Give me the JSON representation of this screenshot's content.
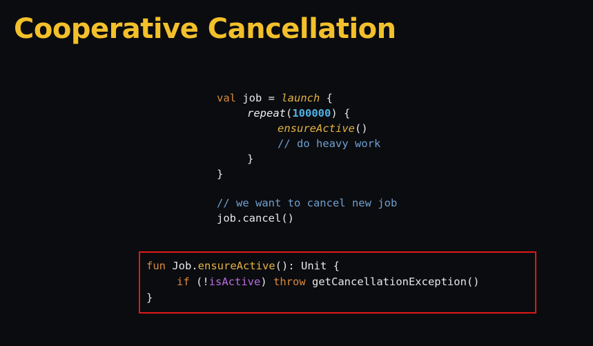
{
  "slide": {
    "title": "Cooperative Cancellation"
  },
  "code_top": {
    "l1_kw": "val",
    "l1_var": " job = ",
    "l1_fn": "launch",
    "l1_end": " {",
    "l2_fn": "repeat",
    "l2_open": "(",
    "l2_num": "100000",
    "l2_close": ") {",
    "l3_fn": "ensureActive",
    "l3_end": "()",
    "l4_comment": "// do heavy work",
    "l5": "}",
    "l6": "}",
    "l7_comment": "// we want to cancel new job",
    "l8": "job.cancel()"
  },
  "code_bottom": {
    "l1_kw": "fun",
    "l1_a": " Job.",
    "l1_fn": "ensureActive",
    "l1_b": "(): Unit {",
    "l2_kw1": "if",
    "l2_a": " (!",
    "l2_prop": "isActive",
    "l2_b": ") ",
    "l2_kw2": "throw",
    "l2_c": " getCancellationException()",
    "l3": "}"
  },
  "colors": {
    "background": "#0b0c10",
    "title": "#f3c02b",
    "highlight_border": "#e01818",
    "keyword": "#d98a3b",
    "function": "#e3b341",
    "number": "#4fb3e6",
    "comment": "#6ea0cf",
    "property": "#b86ee0"
  }
}
